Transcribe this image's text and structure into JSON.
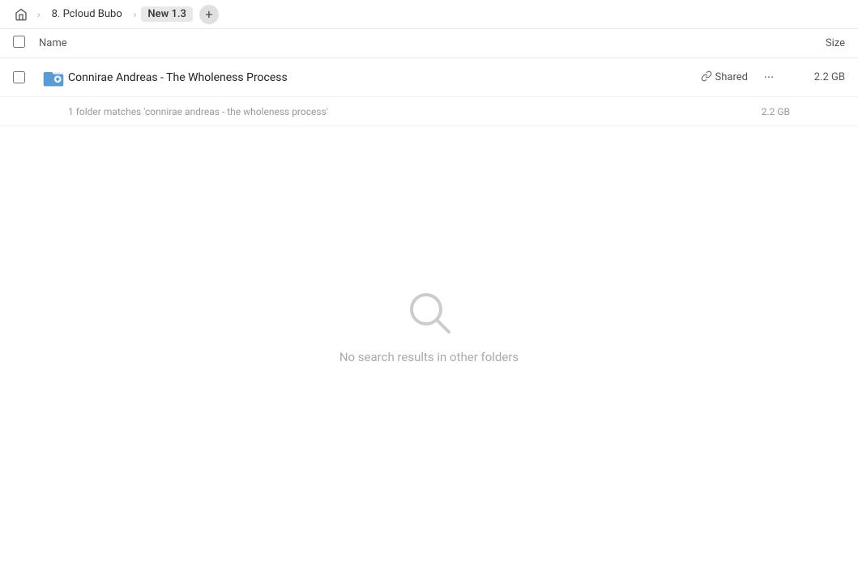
{
  "topbar": {
    "home_icon": "🏠",
    "breadcrumb_items": [
      {
        "label": "8. Pcloud Bubo",
        "active": false
      },
      {
        "label": "New 1.3",
        "active": true
      }
    ],
    "add_icon": "+"
  },
  "columns": {
    "name_label": "Name",
    "size_label": "Size"
  },
  "file_row": {
    "name": "Connirae Andreas - The Wholeness Process",
    "shared_label": "Shared",
    "size": "2.2 GB",
    "more_icon": "···"
  },
  "match_row": {
    "text": "1 folder matches 'connirae andreas - the wholeness process'",
    "size": "2.2 GB"
  },
  "empty_state": {
    "message": "No search results in other folders"
  }
}
